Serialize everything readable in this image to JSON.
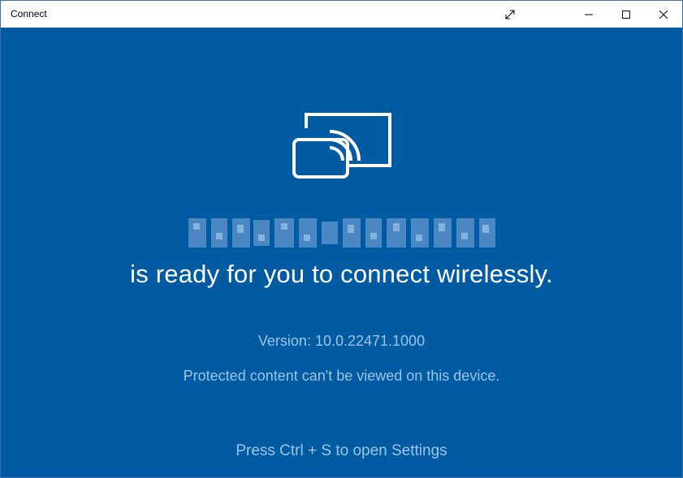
{
  "window": {
    "title": "Connect"
  },
  "titlebar": {
    "icons": [
      "expand-icon",
      "minimize-icon",
      "maximize-icon",
      "close-icon"
    ]
  },
  "main": {
    "icon": "wireless-display-icon",
    "device_name_redacted": true,
    "ready_text": "is ready for you to connect wirelessly.",
    "version_text": "Version: 10.0.22471.1000",
    "protected_text": "Protected content can't be viewed on this device.",
    "settings_hint": "Press Ctrl + S to open Settings"
  },
  "colors": {
    "background": "#005ba3",
    "text_primary": "#ffffff",
    "text_muted": "#9ec3e6"
  }
}
